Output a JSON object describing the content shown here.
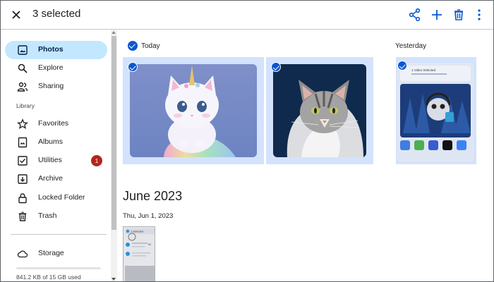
{
  "header": {
    "selection_title": "3 selected",
    "actions": [
      "share-icon",
      "add-icon",
      "trash-icon",
      "more-vert-icon"
    ],
    "accent_color": "#0b57d0"
  },
  "sidebar": {
    "items": [
      {
        "label": "Photos",
        "icon": "photo-icon",
        "active": true
      },
      {
        "label": "Explore",
        "icon": "search-icon"
      },
      {
        "label": "Sharing",
        "icon": "people-icon"
      }
    ],
    "library_label": "Library",
    "library_items": [
      {
        "label": "Favorites",
        "icon": "star-icon"
      },
      {
        "label": "Albums",
        "icon": "album-icon"
      },
      {
        "label": "Utilities",
        "icon": "checkbox-icon",
        "badge": "1"
      },
      {
        "label": "Archive",
        "icon": "archive-icon"
      },
      {
        "label": "Locked Folder",
        "icon": "lock-icon"
      },
      {
        "label": "Trash",
        "icon": "trash-icon"
      }
    ],
    "storage": {
      "label": "Storage",
      "icon": "cloud-icon",
      "usage": "841.2 KB of 15 GB used"
    }
  },
  "main": {
    "groups": [
      {
        "label": "Today",
        "photos": [
          "unicorn-kitten",
          "tabby-cat"
        ]
      },
      {
        "label": "Yesterday",
        "photos": [
          "phone-screenshot"
        ]
      }
    ],
    "month_heading": "June 2023",
    "date_heading": "Thu, Jun 1, 2023",
    "screenshot_text": {
      "title_today": "1 Video Selected",
      "title_june": "1 selected",
      "line": "00"
    }
  }
}
